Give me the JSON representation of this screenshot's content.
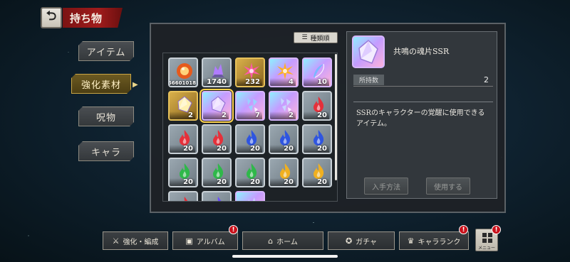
{
  "header": {
    "title": "持ち物",
    "back_icon": "back-arrow-icon"
  },
  "tabs": [
    {
      "label": "アイテム",
      "active": false
    },
    {
      "label": "強化素材",
      "active": true
    },
    {
      "label": "呪物",
      "active": false
    },
    {
      "label": "キャラ",
      "active": false
    }
  ],
  "sort": {
    "label": "種類順"
  },
  "items": [
    {
      "kind": "orb-icon",
      "style": "normal",
      "count": "56601018",
      "small": true,
      "c": "#e65a1c"
    },
    {
      "kind": "crystal-icon",
      "style": "normal",
      "count": "1740",
      "c": "#b07cff"
    },
    {
      "kind": "shard-burst-icon",
      "style": "gold",
      "count": "232",
      "c": "#ff5aa8"
    },
    {
      "kind": "shard-burst-icon",
      "style": "rainbow",
      "count": "4",
      "c": "#ffb020"
    },
    {
      "kind": "feather-icon",
      "style": "rainbow",
      "count": "10",
      "c": "#7ab8ff"
    },
    {
      "kind": "shard-icon",
      "style": "gold",
      "count": "2",
      "c": "#fff0b0"
    },
    {
      "kind": "shard-icon",
      "style": "rainbow",
      "count": "2",
      "c": "#e9d8ff",
      "selected": true
    },
    {
      "kind": "fragments-icon",
      "style": "rainbow",
      "count": "7",
      "c": "#9ad0ff"
    },
    {
      "kind": "fragments-icon",
      "style": "rainbow",
      "count": "2",
      "c": "#c7d6ff"
    },
    {
      "kind": "flame-icon",
      "style": "normal",
      "count": "20",
      "c": "#e5303a"
    },
    {
      "kind": "flame-icon",
      "style": "normal",
      "count": "20",
      "c": "#e5303a"
    },
    {
      "kind": "flame-icon",
      "style": "normal",
      "count": "20",
      "c": "#e5303a"
    },
    {
      "kind": "flame-icon",
      "style": "normal",
      "count": "20",
      "c": "#2f55e0"
    },
    {
      "kind": "flame-icon",
      "style": "normal",
      "count": "20",
      "c": "#2f55e0"
    },
    {
      "kind": "flame-icon",
      "style": "normal",
      "count": "20",
      "c": "#2f55e0"
    },
    {
      "kind": "flame-icon",
      "style": "normal",
      "count": "20",
      "c": "#2fb84a"
    },
    {
      "kind": "flame-icon",
      "style": "normal",
      "count": "20",
      "c": "#2fb84a"
    },
    {
      "kind": "flame-icon",
      "style": "normal",
      "count": "20",
      "c": "#2fb84a"
    },
    {
      "kind": "flame-icon",
      "style": "normal",
      "count": "20",
      "c": "#f0b020"
    },
    {
      "kind": "flame-icon",
      "style": "normal",
      "count": "20",
      "c": "#f0b020"
    },
    {
      "kind": "flame-icon",
      "style": "normal",
      "count": "",
      "c": "#e5303a"
    },
    {
      "kind": "flame-icon",
      "style": "normal",
      "count": "",
      "c": "#6a4cff"
    },
    {
      "kind": "crystal-icon",
      "style": "rainbow",
      "count": "",
      "c": "#c7d6ff"
    }
  ],
  "detail": {
    "name": "共鳴の魂片SSR",
    "owned_label": "所持数",
    "owned_value": "2",
    "description": "SSRのキャラクターの覚醒に使用できるアイテム。",
    "obtain_label": "入手方法",
    "use_label": "使用する"
  },
  "nav": [
    {
      "label": "強化・編成",
      "icon": "party-icon",
      "badge": false
    },
    {
      "label": "アルバム",
      "icon": "album-icon",
      "badge": true
    },
    {
      "label": "ホーム",
      "icon": "home-icon",
      "badge": false
    },
    {
      "label": "ガチャ",
      "icon": "gacha-icon",
      "badge": false
    },
    {
      "label": "キャラランク",
      "icon": "rank-icon",
      "badge": true
    }
  ],
  "menu": {
    "label": "メニュー",
    "badge": true,
    "badge_text": "!"
  },
  "badge_text": "!"
}
